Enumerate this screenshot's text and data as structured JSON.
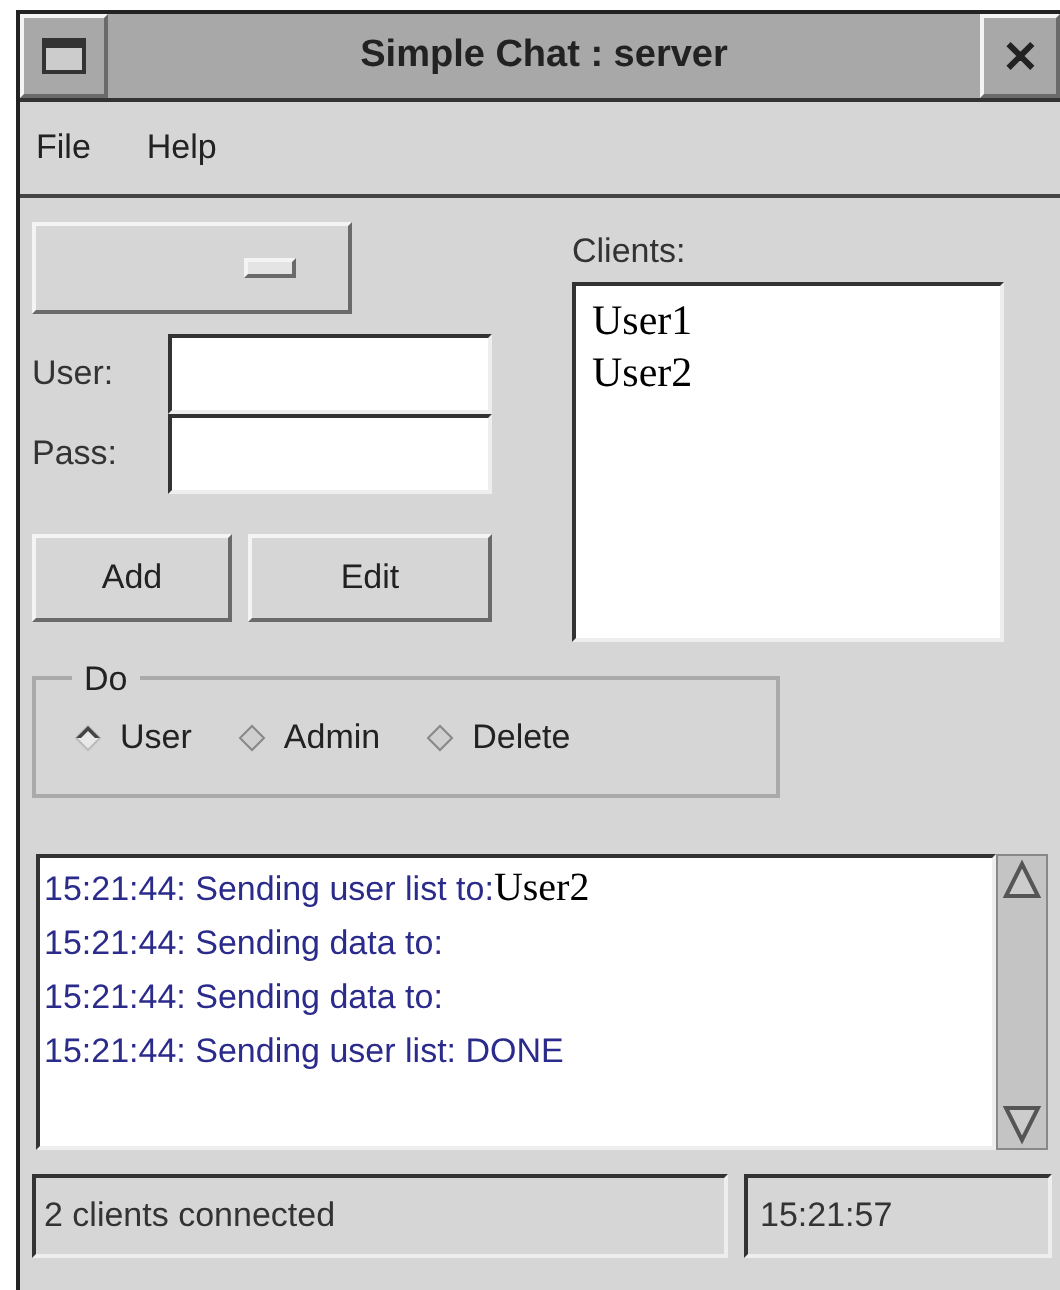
{
  "window": {
    "title": "Simple Chat : server",
    "close": "✕"
  },
  "menu": [
    "File",
    "Help"
  ],
  "form": {
    "user_label": "User:",
    "pass_label": "Pass:",
    "buttons": [
      "Add",
      "Edit"
    ]
  },
  "clients": {
    "label": "Clients:",
    "items": [
      "User1",
      "User2"
    ]
  },
  "do_group": {
    "label": "Do",
    "options": [
      {
        "label": "User",
        "selected": true
      },
      {
        "label": "Admin",
        "selected": false
      },
      {
        "label": "Delete",
        "selected": false
      }
    ]
  },
  "log": [
    {
      "text": "15:21:44: Sending user list to:",
      "name": "User2"
    },
    {
      "text": "15:21:44: Sending data to:"
    },
    {
      "text": "15:21:44: Sending data to:"
    },
    {
      "text": "15:21:44: Sending user list: DONE"
    }
  ],
  "status_bar": {
    "message": "2 clients connected",
    "time": "15:21:57"
  }
}
